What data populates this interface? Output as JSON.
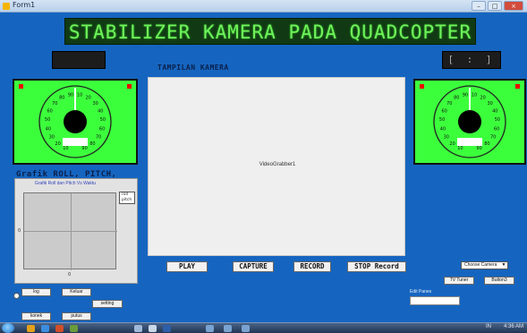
{
  "window": {
    "title": "Form1",
    "min": "–",
    "max": "□",
    "close": "×"
  },
  "banner": {
    "text": "STABILIZER KAMERA PADA QUADCOPTER"
  },
  "led_right": {
    "text": "[ : ]"
  },
  "camera": {
    "section_label": "TAMPILAN KAMERA",
    "placeholder": "VideoGrabber1"
  },
  "gauge": {
    "left_ticks": [
      "10",
      "20",
      "30",
      "40",
      "50",
      "60",
      "70",
      "80",
      "90",
      "10",
      "20",
      "30",
      "40",
      "50",
      "60",
      "70",
      "80",
      "90"
    ],
    "right_ticks": [
      "10",
      "20",
      "30",
      "40",
      "50",
      "60",
      "70",
      "80",
      "90",
      "10",
      "20",
      "30",
      "40",
      "50",
      "60",
      "70",
      "80",
      "90"
    ]
  },
  "chart_section_label": "Grafik ROLL, PITCH,",
  "chart_data": {
    "type": "line",
    "title": "Grafik Roll dan Pitch  Vs Waktu",
    "series": [
      {
        "name": "roll",
        "values": []
      },
      {
        "name": "pitch",
        "values": []
      }
    ],
    "y_tick": "0",
    "x_tick": "0",
    "grid": true,
    "legend": "top-right"
  },
  "buttons": {
    "play": "PLAY",
    "capture": "CAPTURE",
    "record": "RECORD",
    "stop_record": "STOP Record",
    "log": "log",
    "keluar": "Keluar",
    "setting": "setting",
    "konek": "konek",
    "putus": "putus",
    "tv_tuner": "TV Tuner",
    "button3": "Button3"
  },
  "combo": {
    "value": "Choose Camera"
  },
  "text_panel": {
    "label": "Edit Panes"
  },
  "taskbar": {
    "lang": "IN",
    "time": "4:36 AM"
  },
  "colors": {
    "form_bg": "#1565c0",
    "led_green": "#6ff25b",
    "gauge_green": "#3cff3c"
  }
}
